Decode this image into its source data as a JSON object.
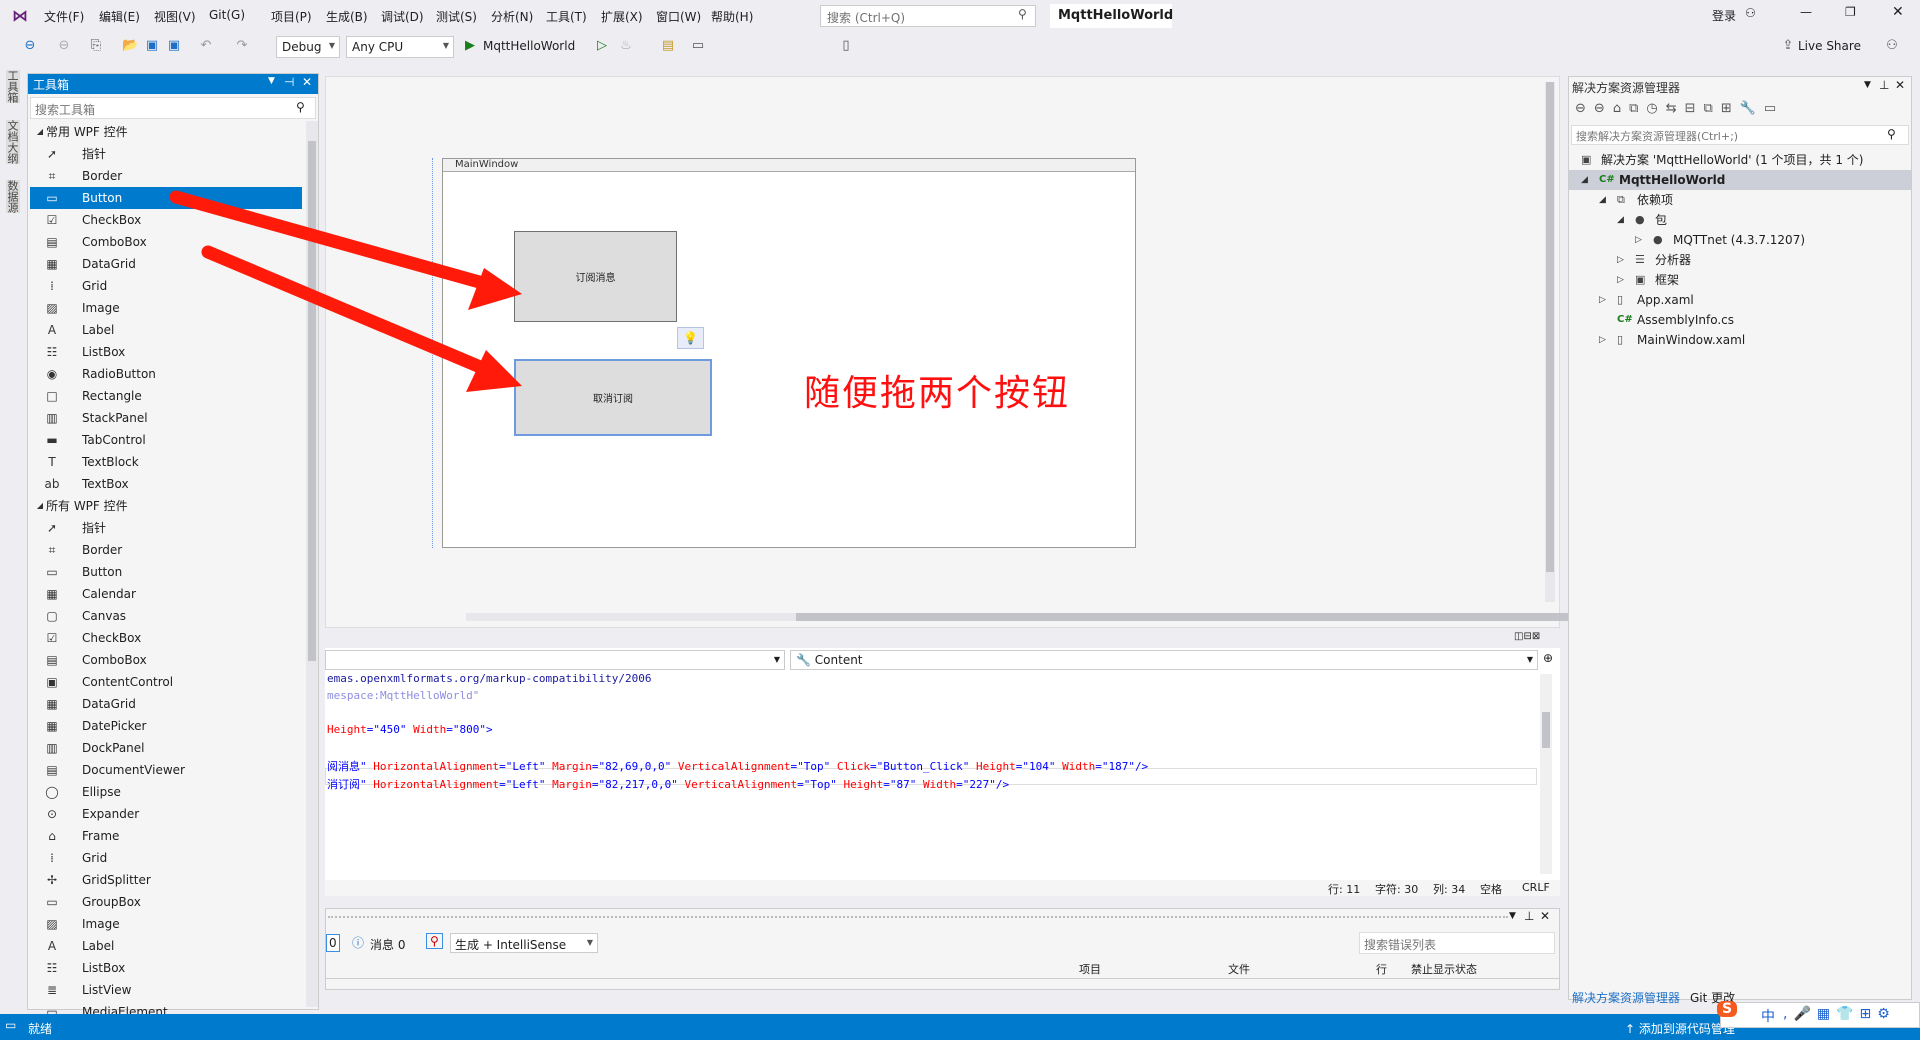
{
  "menu": {
    "items": [
      "文件(F)",
      "编辑(E)",
      "视图(V)",
      "Git(G)",
      "项目(P)",
      "生成(B)",
      "调试(D)",
      "测试(S)",
      "分析(N)",
      "工具(T)",
      "扩展(X)",
      "窗口(W)",
      "帮助(H)"
    ],
    "search_placeholder": "搜索 (Ctrl+Q)",
    "solution_title": "MqttHelloWorld",
    "login": "登录"
  },
  "toolbar": {
    "config": "Debug",
    "platform": "Any CPU",
    "run_target": "MqttHelloWorld",
    "live_share": "Live Share"
  },
  "left_tabs": [
    "工具箱",
    "文档大纲",
    "数据源"
  ],
  "toolbox": {
    "title": "工具箱",
    "search_placeholder": "搜索工具箱",
    "groups": [
      {
        "label": "常用 WPF 控件",
        "items": [
          [
            "pointer-icon",
            "➚",
            "指针"
          ],
          [
            "border-icon",
            "⌗",
            "Border"
          ],
          [
            "button-icon",
            "▭",
            "Button"
          ],
          [
            "checkbox-icon",
            "☑",
            "CheckBox"
          ],
          [
            "combobox-icon",
            "▤",
            "ComboBox"
          ],
          [
            "datagrid-icon",
            "▦",
            "DataGrid"
          ],
          [
            "grid-icon",
            "⁞",
            "Grid"
          ],
          [
            "image-icon",
            "▨",
            "Image"
          ],
          [
            "label-icon",
            "A",
            "Label"
          ],
          [
            "listbox-icon",
            "☷",
            "ListBox"
          ],
          [
            "radiobutton-icon",
            "◉",
            "RadioButton"
          ],
          [
            "rectangle-icon",
            "□",
            "Rectangle"
          ],
          [
            "stackpanel-icon",
            "▥",
            "StackPanel"
          ],
          [
            "tabcontrol-icon",
            "▬",
            "TabControl"
          ],
          [
            "textblock-icon",
            "T",
            "TextBlock"
          ],
          [
            "textbox-icon",
            "ab",
            "TextBox"
          ]
        ]
      },
      {
        "label": "所有 WPF 控件",
        "items": [
          [
            "pointer-icon",
            "➚",
            "指针"
          ],
          [
            "border-icon",
            "⌗",
            "Border"
          ],
          [
            "button-icon",
            "▭",
            "Button"
          ],
          [
            "calendar-icon",
            "▦",
            "Calendar"
          ],
          [
            "canvas-icon",
            "▢",
            "Canvas"
          ],
          [
            "checkbox-icon",
            "☑",
            "CheckBox"
          ],
          [
            "combobox-icon",
            "▤",
            "ComboBox"
          ],
          [
            "contentcontrol-icon",
            "▣",
            "ContentControl"
          ],
          [
            "datagrid-icon",
            "▦",
            "DataGrid"
          ],
          [
            "datepicker-icon",
            "▦",
            "DatePicker"
          ],
          [
            "dockpanel-icon",
            "▥",
            "DockPanel"
          ],
          [
            "documentviewer-icon",
            "▤",
            "DocumentViewer"
          ],
          [
            "ellipse-icon",
            "◯",
            "Ellipse"
          ],
          [
            "expander-icon",
            "⊙",
            "Expander"
          ],
          [
            "frame-icon",
            "⌂",
            "Frame"
          ],
          [
            "grid-icon",
            "⁞",
            "Grid"
          ],
          [
            "gridsplitter-icon",
            "✢",
            "GridSplitter"
          ],
          [
            "groupbox-icon",
            "▭",
            "GroupBox"
          ],
          [
            "image-icon",
            "▨",
            "Image"
          ],
          [
            "label-icon",
            "A",
            "Label"
          ],
          [
            "listbox-icon",
            "☷",
            "ListBox"
          ],
          [
            "listview-icon",
            "≣",
            "ListView"
          ],
          [
            "mediaelement-icon",
            "▭",
            "MediaElement"
          ]
        ]
      }
    ],
    "selected": "Button"
  },
  "designer": {
    "window_title": "MainWindow",
    "button1": "订阅消息",
    "button2": "取消订阅",
    "annotation": "随便拖两个按钮",
    "annotation_color": "#ff1010"
  },
  "code": {
    "left_dropdown": "",
    "right_dropdown": "Content",
    "lines": [
      [
        [
          "emas.openxmlformats.org/markup-compatibility/2006",
          "k-dark"
        ]
      ],
      [
        [
          "mespace:MqttHelloWorld\"",
          "k-gray"
        ]
      ],
      [],
      [
        [
          "Height",
          "k-red"
        ],
        [
          "=\"450\" ",
          "k-blue"
        ],
        [
          "Width",
          "k-red"
        ],
        [
          "=\"800\">",
          "k-blue"
        ]
      ],
      [],
      [
        [
          "阅消息\" ",
          "k-blue"
        ],
        [
          "HorizontalAlignment",
          "k-red"
        ],
        [
          "=\"Left\" ",
          "k-blue"
        ],
        [
          "Margin",
          "k-red"
        ],
        [
          "=\"82,69,0,0\" ",
          "k-blue"
        ],
        [
          "VerticalAlignment",
          "k-red"
        ],
        [
          "=\"Top\" ",
          "k-blue"
        ],
        [
          "Click",
          "k-red"
        ],
        [
          "=\"Button_Click\" ",
          "k-blue"
        ],
        [
          "Height",
          "k-red"
        ],
        [
          "=\"104\" ",
          "k-blue"
        ],
        [
          "Width",
          "k-red"
        ],
        [
          "=\"187\"/>",
          "k-blue"
        ]
      ],
      [
        [
          "消订阅\" ",
          "k-blue"
        ],
        [
          "HorizontalAlignment",
          "k-red"
        ],
        [
          "=\"Left\" ",
          "k-blue"
        ],
        [
          "Margin",
          "k-red"
        ],
        [
          "=\"82,217,0,0\" ",
          "k-blue"
        ],
        [
          "VerticalAlignment",
          "k-red"
        ],
        [
          "=\"Top\" ",
          "k-blue"
        ],
        [
          "Height",
          "k-red"
        ],
        [
          "=\"87\" ",
          "k-blue"
        ],
        [
          "Width",
          "k-red"
        ],
        [
          "=\"227\"/>",
          "k-blue"
        ]
      ]
    ],
    "status": {
      "line": "行: 11",
      "char": "字符: 30",
      "col": "列: 34",
      "spaces": "空格",
      "eol": "CRLF"
    }
  },
  "error_list": {
    "errors_count": "0",
    "messages": "消息 0",
    "scope": "生成 + IntelliSense",
    "search_placeholder": "搜索错误列表",
    "columns": [
      "项目",
      "文件",
      "行",
      "禁止显示状态"
    ]
  },
  "solution_explorer": {
    "title": "解决方案资源管理器",
    "search_placeholder": "搜索解决方案资源管理器(Ctrl+;)",
    "tree": [
      [
        "solution-icon",
        "▣",
        "解决方案 'MqttHelloWorld' (1 个项目，共 1 个)",
        0,
        ""
      ],
      [
        "csharp-project-icon",
        "C#",
        "MqttHelloWorld",
        1,
        "◢"
      ],
      [
        "dependencies-icon",
        "⧉",
        "依赖项",
        2,
        "◢"
      ],
      [
        "package-icon",
        "●",
        "包",
        3,
        "◢"
      ],
      [
        "package-icon",
        "●",
        "MQTTnet (4.3.7.1207)",
        4,
        "▷"
      ],
      [
        "analyzer-icon",
        "☰",
        "分析器",
        3,
        "▷"
      ],
      [
        "framework-icon",
        "▣",
        "框架",
        3,
        "▷"
      ],
      [
        "xaml-file-icon",
        "▯",
        "App.xaml",
        2,
        "▷"
      ],
      [
        "csharp-file-icon",
        "C#",
        "AssemblyInfo.cs",
        2,
        ""
      ],
      [
        "xaml-file-icon",
        "▯",
        "MainWindow.xaml",
        2,
        "▷"
      ]
    ],
    "tabs": [
      "解决方案资源管理器",
      "Git 更改"
    ]
  },
  "status_bar": {
    "ready": "就绪",
    "add_source": "添加到源代码管理",
    "ime": "中"
  },
  "colors": {
    "accent": "#007acc",
    "selection": "#007acc"
  }
}
